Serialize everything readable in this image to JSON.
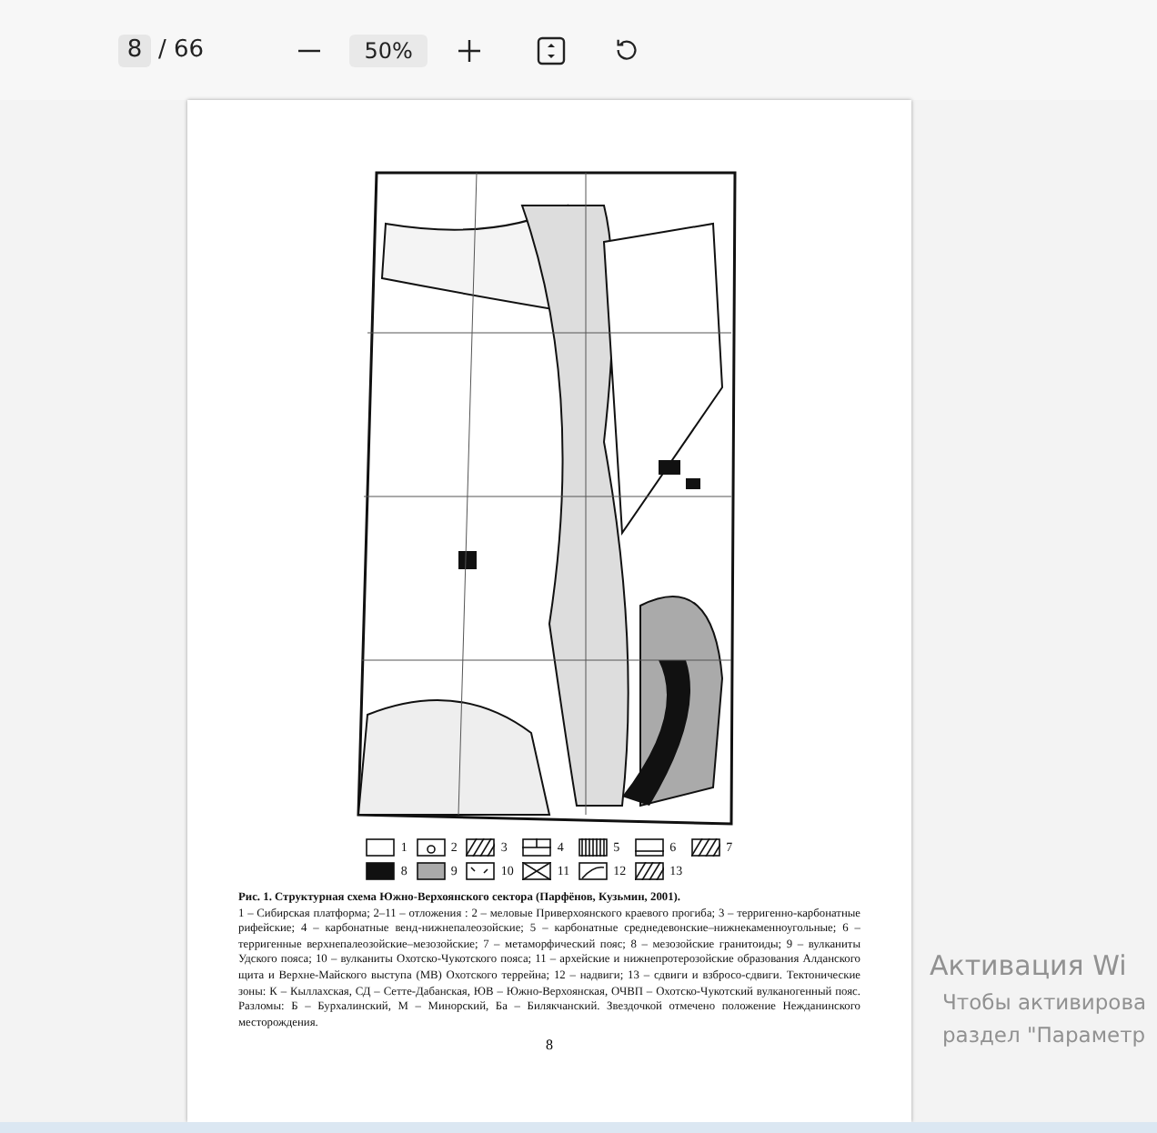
{
  "toolbar": {
    "page_input": "8",
    "page_total": "/ 66",
    "zoom": "50%"
  },
  "document_page": {
    "legend": [
      {
        "label": "1"
      },
      {
        "label": "2"
      },
      {
        "label": "3"
      },
      {
        "label": "4"
      },
      {
        "label": "5"
      },
      {
        "label": "6"
      },
      {
        "label": "7"
      },
      {
        "label": "8"
      },
      {
        "label": "9"
      },
      {
        "label": "10"
      },
      {
        "label": "11"
      },
      {
        "label": "12"
      },
      {
        "label": "13"
      }
    ],
    "caption_title": "Рис. 1. Структурная схема Южно-Верхоянского сектора (Парфёнов, Кузьмин, 2001).",
    "caption_body": "1 – Сибирская платформа; 2–11 – отложения : 2 – меловые Приверхоянского краевого прогиба; 3 – терригенно-карбонатные рифейские; 4 – карбонатные венд-нижнепалеозойские; 5 – карбонатные среднедевонские–нижнекаменноугольные; 6 – терригенные верхнепалеозойские–мезозойские; 7 – метаморфический пояс; 8 – мезозойские гранитоиды; 9 – вулканиты Удского пояса; 10 – вулканиты Охотско-Чукотского пояса; 11 – архейские и нижнепротерозойские образования Алданского щита и Верхне-Майского выступа (МВ) Охотского террейна; 12 – надвиги; 13 – сдвиги и взбросо-сдвиги. Тектонические зоны: К – Кыллахская, СД – Сетте-Дабанская, ЮВ – Южно-Верхоянская, ОЧВП – Охотско-Чукотский вулканогенный пояс. Разломы: Б – Бурхалинский, М – Минорский, Ба – Билякчанский. Звездочкой отмечено положение Нежданинского месторождения.",
    "page_number": "8"
  },
  "activation_notice": [
    "Активация Wi",
    "Чтобы активирова",
    "раздел \"Параметр"
  ]
}
